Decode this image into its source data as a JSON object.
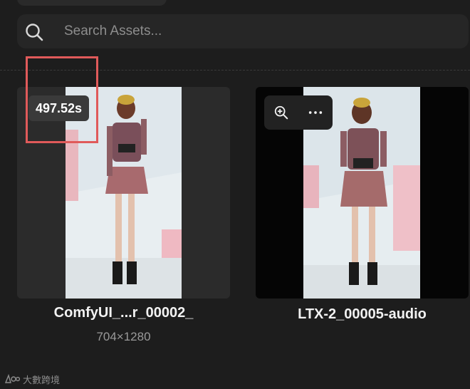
{
  "search": {
    "placeholder": "Search Assets..."
  },
  "assets": [
    {
      "title": "ComfyUI_...r_00002_",
      "meta": "704×1280",
      "badge": "497.52s"
    },
    {
      "title": "LTX-2_00005-audio"
    }
  ],
  "colors": {
    "highlight": "#e05a5a",
    "background": "#1d1d1d"
  },
  "icons": {
    "search": "search-icon",
    "zoom": "zoom-in-icon",
    "more": "more-icon"
  },
  "watermark": {
    "text": "大數跨境"
  }
}
